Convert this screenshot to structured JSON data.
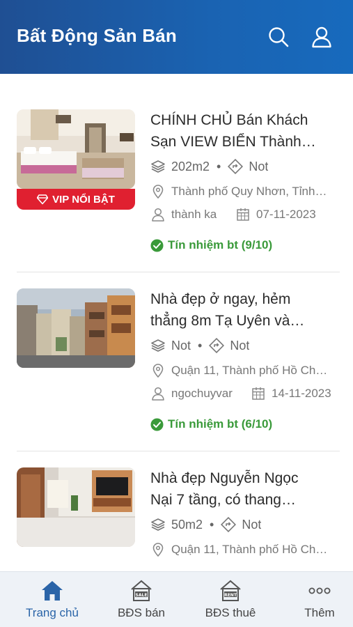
{
  "header": {
    "title": "Bất Động Sản Bán",
    "search_icon": "search-icon",
    "user_icon": "user-icon"
  },
  "listings": [
    {
      "title_line1": "CHÍNH CHỦ Bán Khách",
      "title_line2": "Sạn VIEW BIỂN Thành…",
      "area": "202m2",
      "direction": "Not",
      "location": "Thành phố Quy Nhơn, Tỉnh…",
      "user": "thành ka",
      "date": "07-11-2023",
      "trust": "Tín nhiệm bt (9/10)",
      "vip_label": "VIP NỔI BẬT"
    },
    {
      "title_line1": "Nhà đẹp ở ngay, hẻm",
      "title_line2": "thẳng 8m Tạ Uyên và…",
      "area": "Not",
      "direction": "Not",
      "location": "Quận 11, Thành phố Hồ Ch…",
      "user": "ngochuyvar",
      "date": "14-11-2023",
      "trust": "Tín nhiệm bt (6/10)"
    },
    {
      "title_line1": "Nhà đẹp Nguyễn Ngọc",
      "title_line2": "Nại 7 tầng, có thang…",
      "area": "50m2",
      "direction": "Not",
      "location": "Quận 11, Thành phố Hồ Ch…"
    }
  ],
  "bottom_nav": [
    {
      "label": "Trang chủ",
      "icon": "home-icon",
      "active": true
    },
    {
      "label": "BĐS bán",
      "icon": "sale-house-icon",
      "active": false
    },
    {
      "label": "BĐS thuê",
      "icon": "rent-house-icon",
      "active": false
    },
    {
      "label": "Thêm",
      "icon": "more-icon",
      "active": false
    }
  ],
  "colors": {
    "header_bg": "#1a5fae",
    "vip_badge": "#e02030",
    "trust_green": "#3a9a3a",
    "nav_active": "#2a64a8"
  }
}
